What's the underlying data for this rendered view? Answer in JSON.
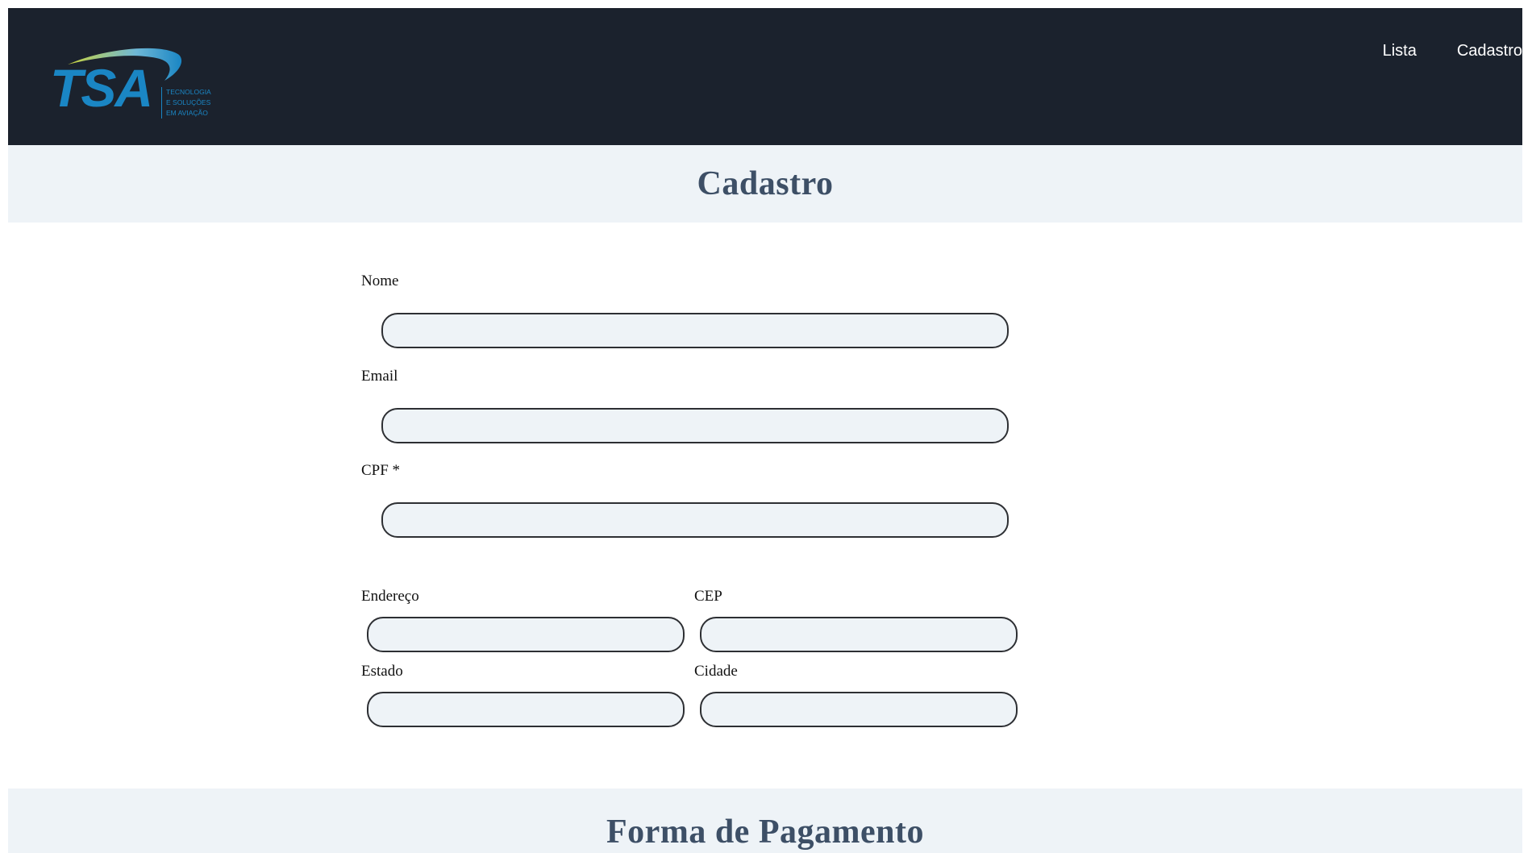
{
  "header": {
    "logo": {
      "text": "TSA",
      "tagline": [
        "TECNOLOGIA",
        "E SOLUÇÕES",
        "EM AVIAÇÃO"
      ]
    },
    "nav": [
      {
        "label": "Lista"
      },
      {
        "label": "Cadastro"
      }
    ],
    "background": "#1b222d"
  },
  "cadastro": {
    "title": "Cadastro",
    "fields": {
      "nome": {
        "label": "Nome",
        "value": ""
      },
      "email": {
        "label": "Email",
        "value": ""
      },
      "cpf": {
        "label": "CPF *",
        "value": ""
      },
      "endereco": {
        "label": "Endereço",
        "value": ""
      },
      "cep": {
        "label": "CEP",
        "value": ""
      },
      "estado": {
        "label": "Estado",
        "value": ""
      },
      "cidade": {
        "label": "Cidade",
        "value": ""
      }
    }
  },
  "pagamento": {
    "title": "Forma de Pagamento"
  },
  "colors": {
    "banner_bg": "#eef3f7",
    "heading": "#3d4f66",
    "logo_blue": "#1a86c4"
  }
}
